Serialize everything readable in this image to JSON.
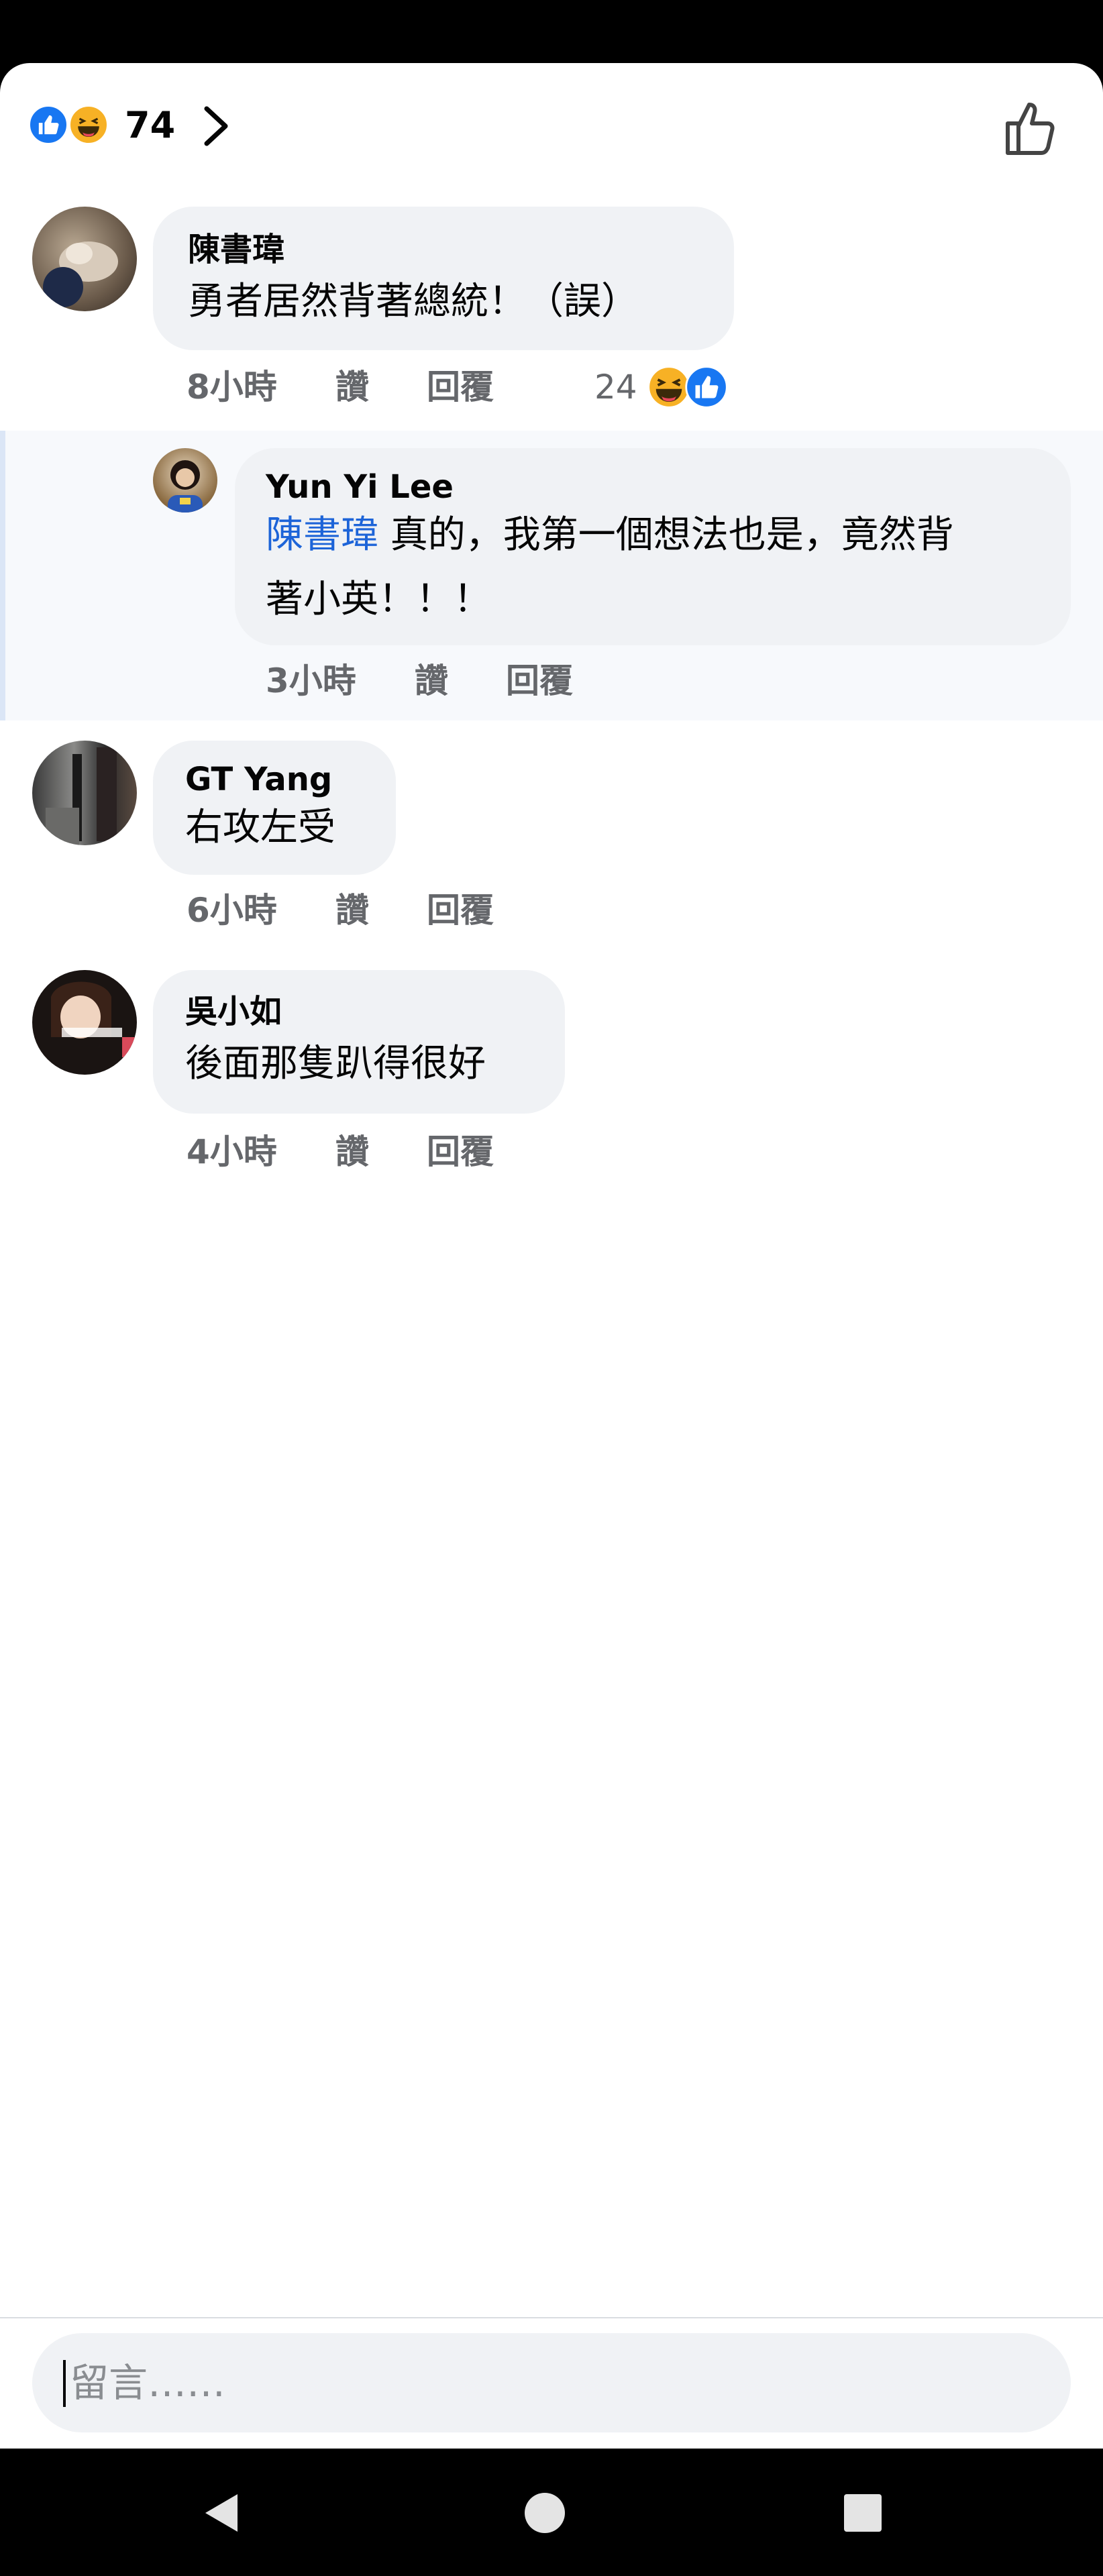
{
  "header": {
    "reaction_count": "74",
    "reaction_icons": [
      "like-icon",
      "haha-icon"
    ],
    "like_button_icon": "thumbs-up-outline-icon"
  },
  "comments": [
    {
      "author": "陳書瑋",
      "text": "勇者居然背著總統！（誤）",
      "time": "8小時",
      "like_label": "讚",
      "reply_label": "回覆",
      "reaction_count": "24",
      "reaction_icons": [
        "haha-icon",
        "like-icon"
      ]
    },
    {
      "author": "Yun Yi Lee",
      "mention": "陳書瑋",
      "text_line1": " 真的，我第一個想法也是，竟然背",
      "text_line2": "著小英！！！",
      "time": "3小時",
      "like_label": "讚",
      "reply_label": "回覆"
    },
    {
      "author": "GT Yang",
      "text": "右攻左受",
      "time": "6小時",
      "like_label": "讚",
      "reply_label": "回覆"
    },
    {
      "author": "吳小如",
      "text": "後面那隻趴得很好",
      "time": "4小時",
      "like_label": "讚",
      "reply_label": "回覆"
    }
  ],
  "composer": {
    "placeholder": "留言……"
  },
  "colors": {
    "like_blue": "#1877f2",
    "haha_yellow": "#f7b125",
    "mention_blue": "#1d64d8",
    "bubble_gray": "#f0f2f5",
    "meta_gray": "#65676b"
  }
}
